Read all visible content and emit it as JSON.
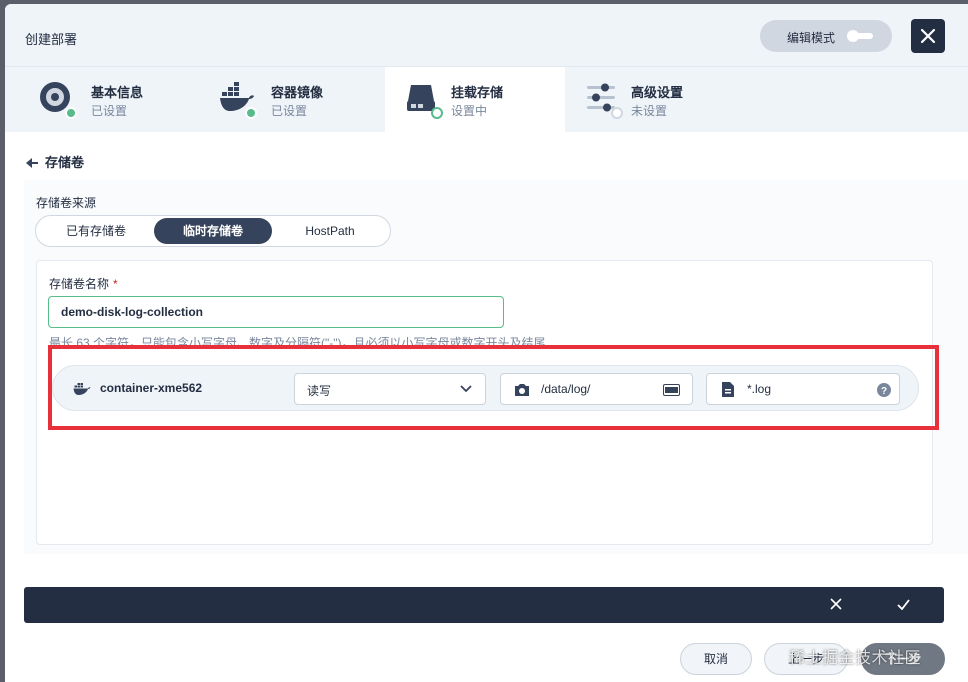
{
  "dialog": {
    "title": "创建部署",
    "edit_mode_label": "编辑模式"
  },
  "steps": [
    {
      "title": "基本信息",
      "status": "已设置"
    },
    {
      "title": "容器镜像",
      "status": "已设置"
    },
    {
      "title": "挂载存储",
      "status": "设置中"
    },
    {
      "title": "高级设置",
      "status": "未设置"
    }
  ],
  "section": {
    "back_title": "存储卷"
  },
  "volume_source": {
    "label": "存储卷来源",
    "options": [
      "已有存储卷",
      "临时存储卷",
      "HostPath"
    ],
    "selected": "临时存储卷"
  },
  "volume_name": {
    "label": "存储卷名称",
    "required_mark": "*",
    "value": "demo-disk-log-collection",
    "hint": "最长 63 个字符，只能包含小写字母、数字及分隔符(\"-\")，且必须以小写字母或数字开头及结尾"
  },
  "mount": {
    "container": "container-xme562",
    "access_mode": "读写",
    "mount_path": "/data/log/",
    "sub_path": "*.log"
  },
  "footer": {
    "cancel": "取消",
    "prev": "上一步",
    "next": "下一步"
  },
  "watermark": "稀土掘金技术社区",
  "colors": {
    "accent": "#55bc8a",
    "dark": "#242e42",
    "highlight": "#e8303a"
  }
}
